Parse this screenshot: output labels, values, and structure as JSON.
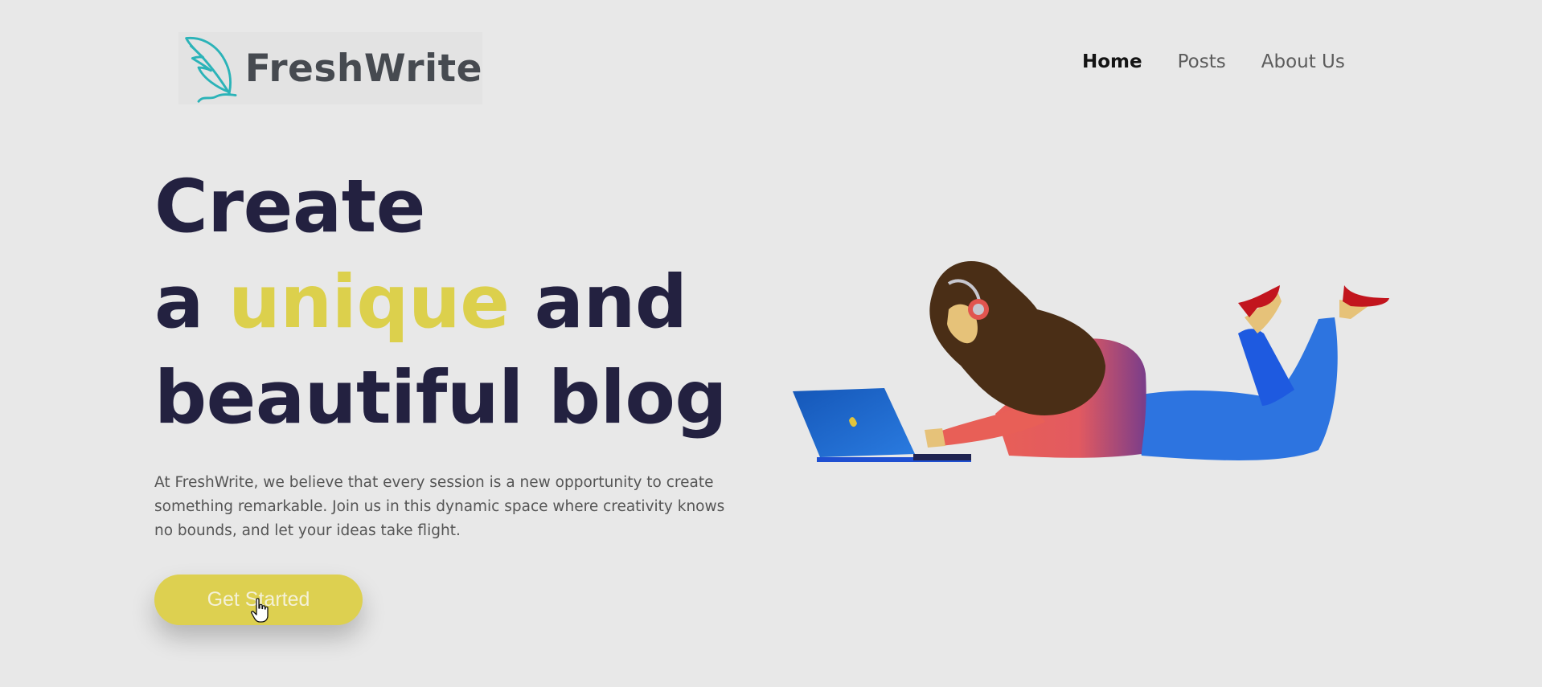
{
  "header": {
    "logo_text": "FreshWrite",
    "logo_icon": "feather-icon",
    "nav": [
      {
        "label": "Home",
        "active": true
      },
      {
        "label": "Posts",
        "active": false
      },
      {
        "label": "About Us",
        "active": false
      }
    ]
  },
  "hero": {
    "line1": "Create",
    "line2_pre": "a ",
    "line2_accent": "unique",
    "line2_post": " and",
    "line3": "beautiful blog",
    "description": "At FreshWrite, we believe that every session is a new opportunity to create something remarkable. Join us in this dynamic space where creativity knows no bounds, and let your ideas take flight.",
    "cta_label": "Get Started"
  },
  "colors": {
    "background": "#e8e8e8",
    "headline": "#232140",
    "accent": "#dcd04c",
    "logo_teal": "#2bb3b8",
    "logo_text": "#464a50"
  }
}
